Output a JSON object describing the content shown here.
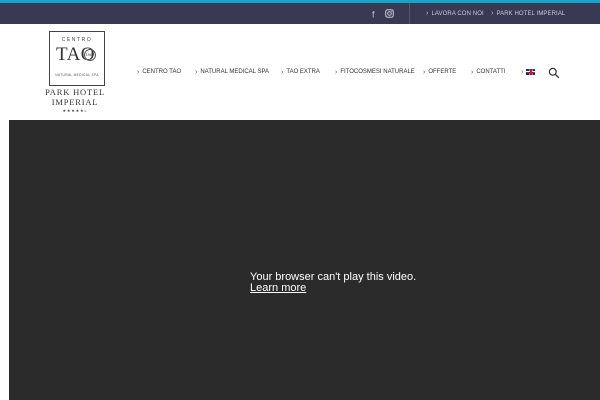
{
  "colors": {
    "accent": "#1aa3c8",
    "topbar_bg": "#383a54",
    "video_bg": "#2b2b2b"
  },
  "topbar": {
    "social": [
      {
        "icon": "facebook-icon",
        "glyph": "f"
      },
      {
        "icon": "instagram-icon"
      }
    ],
    "links": [
      {
        "label": "LAVORA CON NOI"
      },
      {
        "label": "PARK HOTEL IMPERIAL"
      }
    ]
  },
  "logo": {
    "top": "CENTRO",
    "main": "TAO",
    "seal": "1982",
    "tagline": "NATURAL MEDICAL SPA",
    "name_line1": "PARK HOTEL",
    "name_line2": "IMPERIAL",
    "stars": "★★★★★L"
  },
  "nav": {
    "items": [
      {
        "label": "CENTRO TAO"
      },
      {
        "label": "NATURAL MEDICAL SPA"
      },
      {
        "label": "TAO EXTRA"
      },
      {
        "label": "FITOCOSMESI NATURALE"
      },
      {
        "label": "OFFERTE"
      },
      {
        "label": "CONTATTI"
      }
    ],
    "language_icon": "uk-flag-icon",
    "search_icon": "search-icon"
  },
  "video": {
    "message": "Your browser can't play this video.",
    "link": "Learn more"
  }
}
